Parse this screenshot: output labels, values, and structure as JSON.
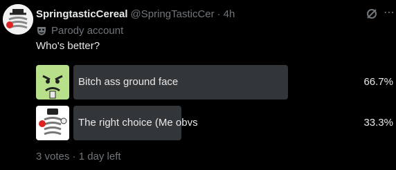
{
  "post": {
    "display_name": "SpringtasticCereal",
    "handle": "@SpringTasticCer",
    "separator": "·",
    "time_ago": "4h",
    "parody_label": "Parody account",
    "text": "Who's better?"
  },
  "poll": {
    "options": [
      {
        "label": "Bitch ass ground face",
        "percent_text": "66.7%",
        "percent": 66.7,
        "image": "green-face-sticker"
      },
      {
        "label": "The right choice (Me obvs",
        "percent_text": "33.3%",
        "percent": 33.3,
        "image": "spring-character-sticker"
      }
    ],
    "footer": "3 votes · 1 day left"
  },
  "icons": {
    "grok": "grok-icon",
    "more": "more-icon",
    "parody": "mask-icon"
  },
  "colors": {
    "background": "#000000",
    "text": "#e7e9ea",
    "secondary_text": "#71767b",
    "poll_bar": "#333639"
  }
}
